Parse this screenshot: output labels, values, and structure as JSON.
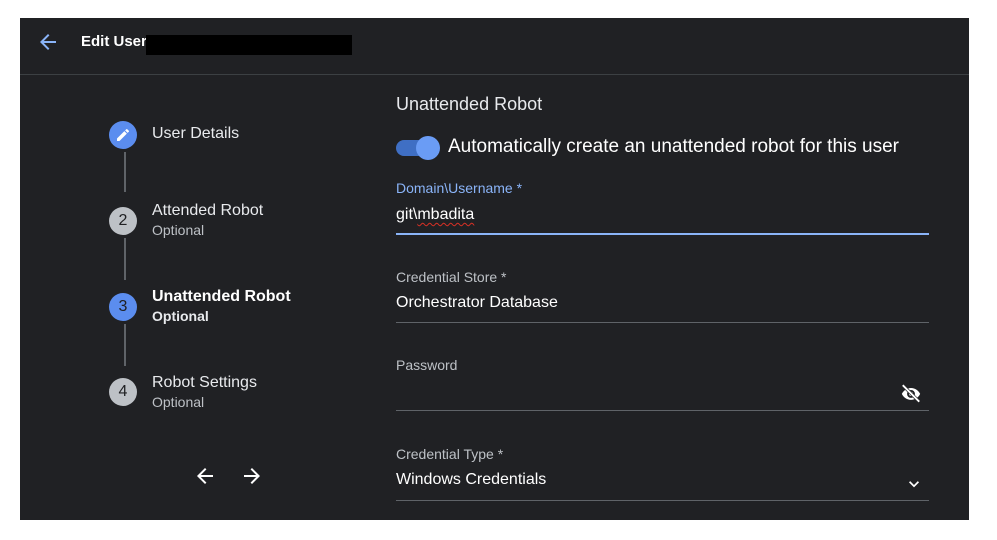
{
  "header": {
    "title": "Edit User:"
  },
  "stepper": {
    "steps": [
      {
        "number": "",
        "title": "User Details",
        "subtitle": ""
      },
      {
        "number": "2",
        "title": "Attended Robot",
        "subtitle": "Optional"
      },
      {
        "number": "3",
        "title": "Unattended Robot",
        "subtitle": "Optional"
      },
      {
        "number": "4",
        "title": "Robot Settings",
        "subtitle": "Optional"
      }
    ]
  },
  "form": {
    "section_title": "Unattended Robot",
    "auto_create_toggle": {
      "label": "Automatically create an unattended robot for this user",
      "on": true
    },
    "domain_username": {
      "label": "Domain\\Username *",
      "value_prefix": "git\\",
      "value_flagged": "mbadita"
    },
    "credential_store": {
      "label": "Credential Store *",
      "value": "Orchestrator Database"
    },
    "password": {
      "label": "Password",
      "value": ""
    },
    "credential_type": {
      "label": "Credential Type *",
      "value": "Windows Credentials"
    }
  },
  "colors": {
    "background": "#202124",
    "accent": "#8ab4f8",
    "step_active": "#5b8def",
    "toggle_track": "#3f6fc4"
  },
  "icons": [
    "back-arrow-icon",
    "pencil-icon",
    "arrow-left-icon",
    "arrow-right-icon",
    "eye-off-icon",
    "chevron-down-icon"
  ]
}
